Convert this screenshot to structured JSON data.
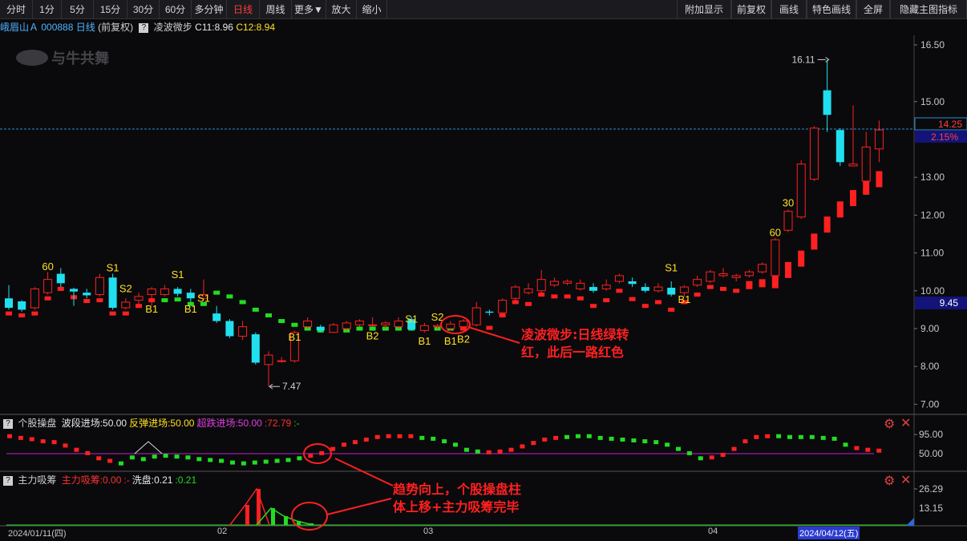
{
  "toolbar": {
    "left_buttons": [
      "分时",
      "1分",
      "5分",
      "15分",
      "30分",
      "60分",
      "多分钟",
      "日线",
      "周线",
      "更多▼",
      "放大",
      "缩小"
    ],
    "active": "日线",
    "right_buttons": [
      "附加显示",
      "前复权",
      "画线",
      "特色画线",
      "全屏",
      "隐藏主图指标"
    ]
  },
  "stock": {
    "name": "峨眉山Ａ",
    "code": "000888",
    "cycle": "日线",
    "adjust": "(前复权)",
    "indicator_name": "凌波微步",
    "c11": "C11:8.96",
    "c12": "C12:8.94"
  },
  "watermark": "与牛共舞",
  "price_axis": {
    "ticks": [
      "16.50",
      "15.00",
      "13.00",
      "12.00",
      "11.00",
      "10.00",
      "9.00",
      "8.00",
      "7.00"
    ],
    "tick_values": [
      16.5,
      15.0,
      13.0,
      12.0,
      11.0,
      10.0,
      9.0,
      8.0,
      7.0
    ],
    "current_price": "14.25",
    "current_pct": "2.15%",
    "cross_price": "9.45",
    "high_label": "16.11",
    "low_label": "7.47"
  },
  "colors": {
    "up": "#ff2020",
    "down": "#20e0f0",
    "green_line": "#22dd22",
    "signal": "#ffe020",
    "purple": "#c020d0"
  },
  "signals": [
    {
      "t": "60",
      "i": 3,
      "p": 10.65
    },
    {
      "t": "S1",
      "i": 8,
      "p": 10.62
    },
    {
      "t": "S2",
      "i": 9,
      "p": 10.07
    },
    {
      "t": "B1",
      "i": 11,
      "p": 9.53
    },
    {
      "t": "S1",
      "i": 13,
      "p": 10.44
    },
    {
      "t": "B1",
      "i": 14,
      "p": 9.53
    },
    {
      "t": "S1",
      "i": 15,
      "p": 9.82
    },
    {
      "t": "B1",
      "i": 22,
      "p": 8.79
    },
    {
      "t": "B2",
      "i": 28,
      "p": 8.82
    },
    {
      "t": "S1",
      "i": 31,
      "p": 9.26
    },
    {
      "t": "B1",
      "i": 32,
      "p": 8.68
    },
    {
      "t": "S2",
      "i": 33,
      "p": 9.32
    },
    {
      "t": "B1",
      "i": 34,
      "p": 8.68
    },
    {
      "t": "B2",
      "i": 35,
      "p": 8.74
    },
    {
      "t": "S1",
      "i": 51,
      "p": 10.62
    },
    {
      "t": "B1",
      "i": 52,
      "p": 9.78
    },
    {
      "t": "60",
      "i": 59,
      "p": 11.55
    },
    {
      "t": "30",
      "i": 60,
      "p": 12.34
    }
  ],
  "sub1": {
    "title": "个股操盘",
    "items": [
      {
        "text": "波段进场:50.00",
        "color": "#e8e8e8"
      },
      {
        "text": "反弹进场:50.00",
        "color": "#ffe020"
      },
      {
        "text": "超跌进场:50.00",
        "color": "#e040e0"
      },
      {
        "text": ":72.79",
        "color": "#ff3030"
      },
      {
        "text": ":-",
        "color": "#20dd20"
      }
    ],
    "ticks": [
      "95.00",
      "50.00"
    ]
  },
  "sub2": {
    "title": "主力吸筹",
    "items": [
      {
        "text": "主力吸筹:0.00",
        "color": "#ff3030"
      },
      {
        "text": ":-",
        "color": "#ff3030"
      },
      {
        "text": "洗盘:0.21",
        "color": "#e8e8e8"
      },
      {
        "text": ":0.21",
        "color": "#20dd20"
      }
    ],
    "ticks": [
      "26.29",
      "13.15"
    ]
  },
  "dates": {
    "labels": [
      "2024/01/11(四)",
      "02",
      "03",
      "04"
    ],
    "current": "2024/04/12(五)"
  },
  "annotations": {
    "a1_line1": "凌波微步:日线绿转",
    "a1_line2": "红，此后一路红色",
    "a2_line1": "趋势向上，个股操盘柱",
    "a2_line2": "体上移+主力吸筹完毕"
  },
  "chart_data": {
    "type": "candlestick",
    "x_range": [
      "2024/01/11",
      "2024/04/12"
    ],
    "ylim": [
      7.0,
      16.5
    ],
    "candles": [
      [
        9.8,
        9.55,
        10.15,
        9.5
      ],
      [
        9.72,
        9.5,
        9.75,
        9.45
      ],
      [
        9.55,
        10.05,
        10.1,
        9.5
      ],
      [
        9.95,
        10.3,
        10.5,
        9.9
      ],
      [
        10.45,
        10.2,
        10.6,
        10.1
      ],
      [
        10.05,
        9.98,
        10.08,
        9.6
      ],
      [
        9.95,
        9.88,
        10.05,
        9.8
      ],
      [
        9.9,
        10.35,
        10.45,
        9.85
      ],
      [
        10.35,
        9.55,
        10.45,
        9.5
      ],
      [
        9.55,
        9.7,
        9.8,
        9.5
      ],
      [
        9.75,
        9.85,
        9.95,
        9.6
      ],
      [
        9.9,
        10.05,
        10.1,
        9.6
      ],
      [
        9.9,
        10.05,
        10.15,
        9.85
      ],
      [
        10.05,
        9.92,
        10.1,
        9.85
      ],
      [
        9.95,
        9.8,
        10.05,
        9.7
      ],
      [
        9.8,
        9.9,
        10.3,
        9.75
      ],
      [
        9.4,
        9.2,
        9.6,
        9.15
      ],
      [
        9.2,
        8.8,
        9.25,
        8.75
      ],
      [
        8.8,
        9.05,
        9.2,
        8.7
      ],
      [
        8.85,
        8.1,
        8.9,
        8.05
      ],
      [
        8.05,
        8.3,
        8.4,
        7.47
      ],
      [
        8.15,
        8.15,
        8.25,
        8.1
      ],
      [
        8.15,
        8.9,
        8.95,
        8.1
      ],
      [
        9.05,
        9.2,
        9.3,
        9.0
      ],
      [
        9.05,
        8.95,
        9.1,
        8.9
      ],
      [
        8.9,
        9.1,
        9.15,
        8.88
      ],
      [
        9.0,
        9.15,
        9.2,
        8.95
      ],
      [
        9.1,
        9.2,
        9.25,
        9.05
      ],
      [
        9.1,
        9.1,
        9.3,
        9.05
      ],
      [
        9.1,
        9.15,
        9.2,
        9.0
      ],
      [
        9.05,
        9.2,
        9.3,
        9.0
      ],
      [
        9.25,
        8.98,
        9.3,
        8.95
      ],
      [
        8.95,
        9.08,
        9.15,
        8.9
      ],
      [
        9.05,
        9.08,
        9.12,
        9.0
      ],
      [
        9.0,
        9.12,
        9.2,
        8.95
      ],
      [
        9.05,
        9.2,
        9.25,
        9.0
      ],
      [
        9.1,
        9.55,
        9.7,
        9.05
      ],
      [
        9.45,
        9.42,
        9.5,
        9.35
      ],
      [
        9.42,
        9.75,
        9.8,
        9.4
      ],
      [
        9.8,
        10.1,
        10.15,
        9.75
      ],
      [
        9.95,
        10.05,
        10.2,
        9.9
      ],
      [
        10.0,
        10.3,
        10.55,
        9.95
      ],
      [
        10.15,
        10.25,
        10.35,
        10.1
      ],
      [
        10.2,
        10.25,
        10.3,
        10.15
      ],
      [
        10.05,
        10.2,
        10.3,
        10.0
      ],
      [
        10.1,
        10.0,
        10.2,
        9.95
      ],
      [
        10.05,
        10.15,
        10.3,
        10.0
      ],
      [
        10.25,
        10.4,
        10.45,
        10.2
      ],
      [
        10.25,
        10.18,
        10.35,
        10.1
      ],
      [
        10.1,
        10.0,
        10.2,
        9.95
      ],
      [
        10.0,
        10.1,
        10.2,
        9.95
      ],
      [
        10.08,
        9.9,
        10.25,
        9.85
      ],
      [
        9.95,
        10.1,
        10.15,
        9.85
      ],
      [
        10.15,
        10.3,
        10.4,
        10.1
      ],
      [
        10.25,
        10.5,
        10.55,
        10.2
      ],
      [
        10.4,
        10.45,
        10.6,
        10.35
      ],
      [
        10.35,
        10.4,
        10.45,
        10.25
      ],
      [
        10.4,
        10.5,
        10.55,
        10.35
      ],
      [
        10.5,
        10.7,
        10.75,
        10.45
      ],
      [
        10.4,
        11.35,
        11.4,
        10.4
      ],
      [
        11.6,
        12.1,
        12.15,
        11.55
      ],
      [
        11.95,
        13.35,
        13.45,
        11.9
      ],
      [
        12.95,
        14.3,
        14.35,
        12.9
      ],
      [
        15.3,
        14.65,
        16.11,
        14.2
      ],
      [
        14.25,
        13.4,
        14.3,
        13.3
      ],
      [
        13.3,
        13.35,
        14.9,
        13.3
      ],
      [
        12.9,
        13.8,
        14.2,
        12.85
      ],
      [
        13.75,
        14.25,
        14.5,
        13.4
      ]
    ]
  }
}
